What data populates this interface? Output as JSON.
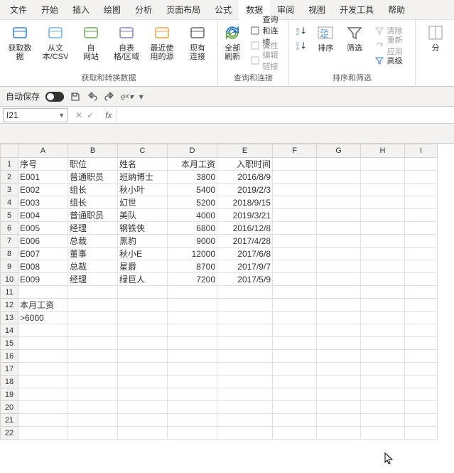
{
  "tabs": [
    "文件",
    "开始",
    "插入",
    "绘图",
    "分析",
    "页面布局",
    "公式",
    "数据",
    "审阅",
    "视图",
    "开发工具",
    "帮助"
  ],
  "active_tab": "数据",
  "ribbon": {
    "g1": {
      "label": "获取和转换数据",
      "buttons": [
        {
          "l1": "获取数",
          "l2": "据"
        },
        {
          "l1": "从文",
          "l2": "本/CSV"
        },
        {
          "l1": "自",
          "l2": "网站"
        },
        {
          "l1": "自表",
          "l2": "格/区域"
        },
        {
          "l1": "最近使",
          "l2": "用的源"
        },
        {
          "l1": "现有",
          "l2": "连接"
        }
      ]
    },
    "g2": {
      "label": "查询和连接",
      "main": {
        "l1": "全部刷新",
        "l2": ""
      },
      "items": [
        "查询和连接",
        "属性",
        "编辑链接"
      ]
    },
    "g3": {
      "label": "排序和筛选",
      "az": "A→Z",
      "za": "Z→A",
      "sort": "排序",
      "filter": "筛选",
      "clear": "清除",
      "reapply": "重新应用",
      "advanced": "高级"
    },
    "g4": {
      "label": "分"
    }
  },
  "qat": {
    "autosave": "自动保存"
  },
  "namebox": "I21",
  "fx_label": "fx",
  "columns": [
    "A",
    "B",
    "C",
    "D",
    "E",
    "F",
    "G",
    "H",
    "I"
  ],
  "table": {
    "headers": {
      "A": "序号",
      "B": "职位",
      "C": "姓名",
      "D": "本月工资",
      "E": "入职时间"
    },
    "rows": [
      {
        "A": "E001",
        "B": "普通职员",
        "C": "班纳博士",
        "D": 3800,
        "E": "2016/8/9"
      },
      {
        "A": "E002",
        "B": "组长",
        "C": "秋小叶",
        "D": 5400,
        "E": "2019/2/3"
      },
      {
        "A": "E003",
        "B": "组长",
        "C": "幻世",
        "D": 5200,
        "E": "2018/9/15"
      },
      {
        "A": "E004",
        "B": "普通职员",
        "C": "美队",
        "D": 4000,
        "E": "2019/3/21"
      },
      {
        "A": "E005",
        "B": "经理",
        "C": "钢铁侠",
        "D": 6800,
        "E": "2016/12/8"
      },
      {
        "A": "E006",
        "B": "总裁",
        "C": "黑豹",
        "D": 9000,
        "E": "2017/4/28"
      },
      {
        "A": "E007",
        "B": "董事",
        "C": "秋小E",
        "D": 12000,
        "E": "2017/6/8"
      },
      {
        "A": "E008",
        "B": "总裁",
        "C": "星爵",
        "D": 8700,
        "E": "2017/9/7"
      },
      {
        "A": "E009",
        "B": "经理",
        "C": "绿巨人",
        "D": 7200,
        "E": "2017/5/9"
      }
    ],
    "criteria": {
      "label": "本月工资",
      "value": ">6000"
    }
  },
  "rowcount": 22
}
